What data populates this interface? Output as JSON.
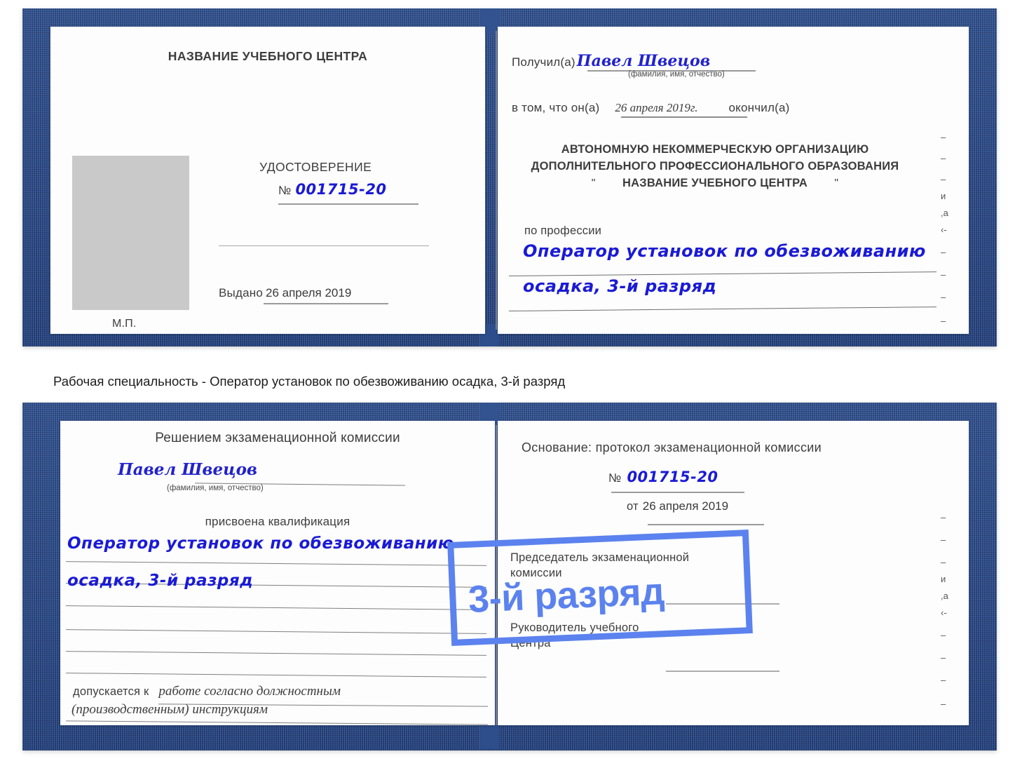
{
  "document": {
    "kind": "certificate-booklet",
    "colors": {
      "cover": "#2a4a8c",
      "paper": "#fdfdfd",
      "ink_blue": "#1a1ad6",
      "highlight_blue": "#5b82ee",
      "photo_placeholder": "#c9c9c9",
      "rule": "#8f8f8f",
      "text": "#3a3a3a"
    }
  },
  "caption": {
    "text": "Рабочая специальность - Оператор установок по обезвоживанию осадка, 3-й разряд"
  },
  "badge": {
    "text": "3-й разряд"
  },
  "top_certificate": {
    "left_page": {
      "header": "НАЗВАНИЕ УЧЕБНОГО ЦЕНТРА",
      "title": "УДОСТОВЕРЕНИЕ",
      "number_label": "№",
      "number_value": "001715-20",
      "issued_label": "Выдано",
      "issued_value": "26 апреля 2019",
      "stamp_label": "М.П.",
      "photo_placeholder_label": "photo-placeholder"
    },
    "right_page": {
      "received_label": "Получил(а)",
      "received_value": "Павел Швецов",
      "received_hint": "(фамилия, имя, отчество)",
      "in_that_label": "в том, что он(а)",
      "in_that_value": "26 апреля 2019г.",
      "finished_label": "окончил(а)",
      "org_line1": "АВТОНОМНУЮ НЕКОММЕРЧЕСКУЮ ОРГАНИЗАЦИЮ",
      "org_line2": "ДОПОЛНИТЕЛЬНОГО ПРОФЕССИОНАЛЬНОГО ОБРАЗОВАНИЯ",
      "org_quote_open": "\"",
      "org_name": "НАЗВАНИЕ УЧЕБНОГО ЦЕНТРА",
      "org_quote_close": "\"",
      "profession_label": "по профессии",
      "profession_line1": "Оператор установок по обезвоживанию",
      "profession_line2": "осадка, 3-й разряд",
      "edge_marks": [
        "–",
        "–",
        "–",
        "и",
        ",а",
        "‹-",
        "–",
        "–",
        "–",
        "–"
      ]
    }
  },
  "bottom_certificate": {
    "left_page": {
      "header": "Решением экзаменационной комиссии",
      "name_value": "Павел Швецов",
      "name_hint": "(фамилия, имя, отчество)",
      "qualification_label": "присвоена квалификация",
      "qualification_line1": "Оператор установок по обезвоживанию",
      "qualification_line2": "осадка, 3-й разряд",
      "admitted_label": "допускается к",
      "admitted_line1": "работе согласно должностным",
      "admitted_line2": "(производственным) инструкциям"
    },
    "right_page": {
      "basis_label": "Основание: протокол экзаменационной комиссии",
      "number_label": "№",
      "number_value": "001715-20",
      "date_label": "от",
      "date_value": "26 апреля 2019",
      "chairman_line1": "Председатель экзаменационной",
      "chairman_line2": "комиссии",
      "head_line1": "Руководитель учебного",
      "head_line2": "Центра",
      "edge_marks": [
        "–",
        "–",
        "–",
        "и",
        ",а",
        "‹-",
        "–",
        "–",
        "–",
        "–"
      ]
    }
  }
}
